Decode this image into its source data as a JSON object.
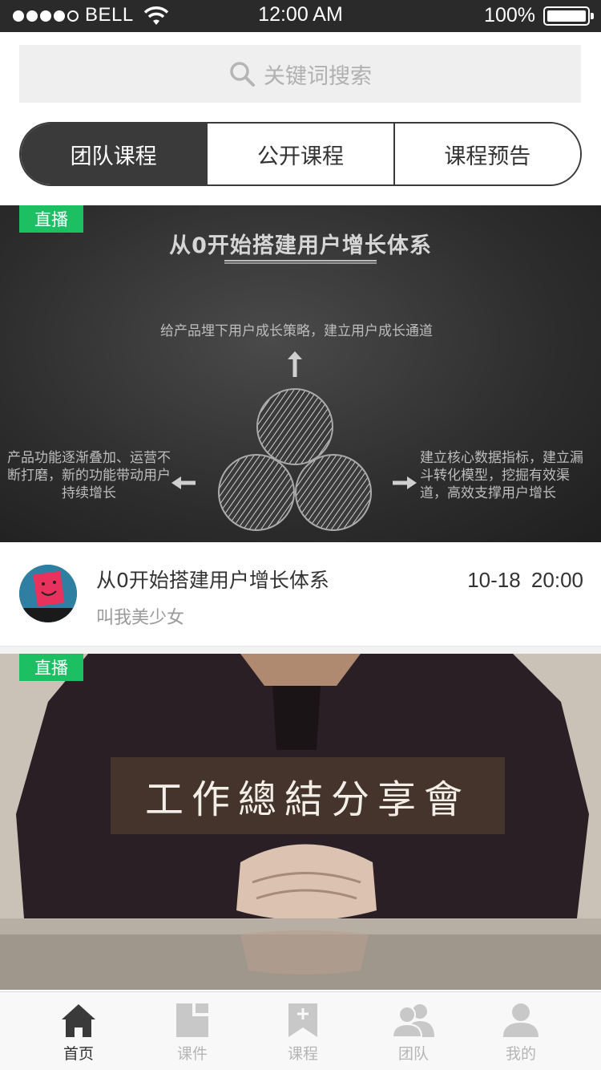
{
  "status_bar": {
    "carrier": "BELL",
    "time": "12:00 AM",
    "battery": "100%"
  },
  "search": {
    "placeholder": "关键词搜索"
  },
  "tabs": [
    {
      "label": "团队课程",
      "active": true
    },
    {
      "label": "公开课程",
      "active": false
    },
    {
      "label": "课程预告",
      "active": false
    }
  ],
  "courses": [
    {
      "badge": "直播",
      "banner": {
        "title": "从0开始搭建用户增长体系",
        "top_text": "给产品埋下用户成长策略，建立用户成长通道",
        "left_text": "产品功能逐渐叠加、运营不断打磨，新的功能带动用户持续增长",
        "right_text": "建立核心数据指标，建立漏斗转化模型，挖掘有效渠道，高效支撑用户增长"
      },
      "title": "从0开始搭建用户增长体系",
      "author": "叫我美少女",
      "date": "10-18",
      "time": "20:00"
    },
    {
      "badge": "直播",
      "banner": {
        "title": "工作總結分享會"
      }
    }
  ],
  "bottom_nav": [
    {
      "label": "首页",
      "icon": "home-icon",
      "active": true
    },
    {
      "label": "课件",
      "icon": "courseware-icon",
      "active": false
    },
    {
      "label": "课程",
      "icon": "course-bookmark-icon",
      "active": false
    },
    {
      "label": "团队",
      "icon": "team-icon",
      "active": false
    },
    {
      "label": "我的",
      "icon": "profile-icon",
      "active": false
    }
  ],
  "colors": {
    "live_badge": "#1dbf63",
    "tab_active": "#3a3a3a",
    "nav_active": "#333333",
    "nav_inactive": "#b5b5b5"
  }
}
